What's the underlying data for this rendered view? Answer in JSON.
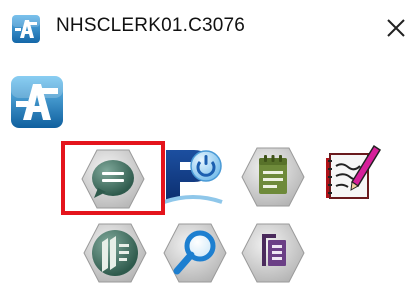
{
  "window": {
    "title": "NHSCLERK01.C3076",
    "app_icon": "app-a-icon",
    "close_icon": "close-icon"
  },
  "brand": {
    "icon": "brand-a-logo"
  },
  "launcher": {
    "rows": [
      {
        "tiles": [
          {
            "icon": "chat-bubble-icon",
            "selected": true
          },
          {
            "icon": "p-power-icon",
            "selected": false
          },
          {
            "icon": "notepad-icon",
            "selected": false
          },
          {
            "icon": "notebook-pen-icon",
            "selected": false
          }
        ]
      },
      {
        "tiles": [
          {
            "icon": "page-stack-icon",
            "selected": false
          },
          {
            "icon": "magnifier-icon",
            "selected": false
          },
          {
            "icon": "document-stack-icon",
            "selected": false
          }
        ]
      }
    ]
  },
  "colors": {
    "selection_border": "#e4141c",
    "brand_blue": "#1e86c8"
  }
}
